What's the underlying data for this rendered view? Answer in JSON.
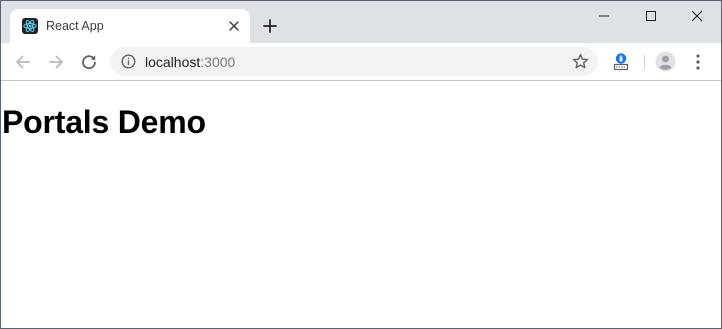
{
  "browser": {
    "tab": {
      "title": "React App",
      "favicon": "react-logo-icon"
    },
    "address_bar": {
      "host": "localhost",
      "port": ":3000",
      "security_icon": "info-icon"
    },
    "toolbar_icons": [
      "back-arrow-icon",
      "forward-arrow-icon",
      "reload-icon",
      "star-icon",
      "extension-icon",
      "profile-icon",
      "kebab-menu-icon"
    ],
    "window_controls": [
      "minimize-icon",
      "maximize-icon",
      "close-icon"
    ]
  },
  "page": {
    "heading": "Portals Demo"
  },
  "colors": {
    "tabstrip": "#dee1e6",
    "omnibox": "#f1f3f4",
    "react_logo": "#61dafb",
    "extension_accent": "#1a73e8"
  }
}
